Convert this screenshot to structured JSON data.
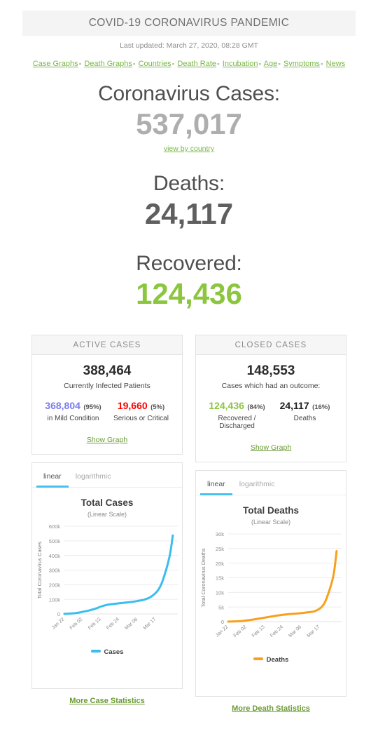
{
  "header": {
    "title": "COVID-19 CORONAVIRUS PANDEMIC",
    "last_updated": "Last updated: March 27, 2020, 08:28 GMT",
    "nav": [
      "Case Graphs",
      "Death Graphs",
      "Countries",
      "Death Rate",
      "Incubation",
      "Age",
      "Symptoms",
      "News"
    ],
    "nav_separator": "-"
  },
  "counters": {
    "cases": {
      "label": "Coronavirus Cases:",
      "value": "537,017",
      "link": "view by country",
      "color": "#aeaeae"
    },
    "deaths": {
      "label": "Deaths:",
      "value": "24,117",
      "color": "#5f5f5f"
    },
    "recovered": {
      "label": "Recovered:",
      "value": "124,436",
      "color": "#8cc63f"
    }
  },
  "panels": {
    "active": {
      "heading": "ACTIVE CASES",
      "total": "388,464",
      "total_label": "Currently Infected Patients",
      "left": {
        "value": "368,804",
        "pct": "(95%)",
        "label": "in Mild Condition",
        "color": "#7b7bea"
      },
      "right": {
        "value": "19,660",
        "pct": "(5%)",
        "label": "Serious or Critical",
        "color": "#ff0000"
      },
      "show_graph": "Show Graph"
    },
    "closed": {
      "heading": "CLOSED CASES",
      "total": "148,553",
      "total_label": "Cases which had an outcome:",
      "left": {
        "value": "124,436",
        "pct": "(84%)",
        "label": "Recovered / Discharged",
        "color": "#8cc63f"
      },
      "right": {
        "value": "24,117",
        "pct": "(16%)",
        "label": "Deaths",
        "color": "#1f1f1f"
      },
      "show_graph": "Show Graph"
    }
  },
  "charts": {
    "cases": {
      "tabs": {
        "linear": "linear",
        "logarithmic": "logarithmic",
        "active": "linear"
      },
      "more_link": "More Case Statistics"
    },
    "deaths": {
      "tabs": {
        "linear": "linear",
        "logarithmic": "logarithmic",
        "active": "linear"
      },
      "more_link": "More Death Statistics"
    }
  },
  "chart_data": [
    {
      "type": "line",
      "id": "total-cases",
      "title": "Total Cases",
      "subtitle": "(Linear Scale)",
      "xlabel": "",
      "ylabel": "Total Coronavirus Cases",
      "ylim": [
        0,
        600000
      ],
      "yticks": [
        0,
        100000,
        200000,
        300000,
        400000,
        500000,
        600000
      ],
      "ytick_labels": [
        "0",
        "100k",
        "200k",
        "300k",
        "400k",
        "500k",
        "600k"
      ],
      "xtick_labels": [
        "Jan 22",
        "Feb 02",
        "Feb 13",
        "Feb 24",
        "Mar 06",
        "Mar 17"
      ],
      "grid": true,
      "legend": [
        "Cases"
      ],
      "legend_position": "bottom",
      "color": "#3bbdef",
      "x": [
        0,
        4,
        8,
        11,
        15,
        19,
        22,
        26,
        30,
        33,
        37,
        41,
        44,
        48,
        52,
        56,
        59,
        63,
        65
      ],
      "values": [
        555,
        2800,
        7800,
        14600,
        24500,
        37500,
        51000,
        63000,
        69000,
        73000,
        78000,
        83000,
        89000,
        98000,
        118000,
        160000,
        230000,
        390000,
        537017
      ]
    },
    {
      "type": "line",
      "id": "total-deaths",
      "title": "Total Deaths",
      "subtitle": "(Linear Scale)",
      "xlabel": "",
      "ylabel": "Total Coronavirus Deaths",
      "ylim": [
        0,
        30000
      ],
      "yticks": [
        0,
        5000,
        10000,
        15000,
        20000,
        25000,
        30000
      ],
      "ytick_labels": [
        "0",
        "5k",
        "10k",
        "15k",
        "20k",
        "25k",
        "30k"
      ],
      "xtick_labels": [
        "Jan 22",
        "Feb 02",
        "Feb 13",
        "Feb 24",
        "Mar 06",
        "Mar 17"
      ],
      "grid": true,
      "legend": [
        "Deaths"
      ],
      "legend_position": "bottom",
      "color": "#f7a01d",
      "x": [
        0,
        4,
        8,
        11,
        15,
        19,
        22,
        26,
        30,
        33,
        37,
        41,
        44,
        48,
        52,
        56,
        59,
        63,
        65
      ],
      "values": [
        17,
        80,
        210,
        425,
        720,
        1115,
        1380,
        1770,
        2130,
        2360,
        2620,
        2770,
        2940,
        3200,
        3600,
        5000,
        8000,
        15500,
        24117
      ]
    }
  ]
}
